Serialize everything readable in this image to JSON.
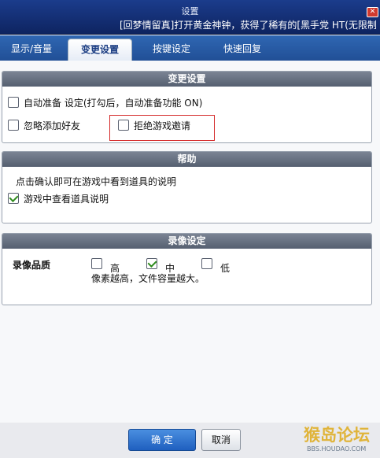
{
  "window": {
    "title": "设置",
    "marquee": "[回梦情留真]打开黄金神钟，获得了稀有的[黑手党 HT(无限制"
  },
  "tabs": [
    {
      "label": "显示/音量"
    },
    {
      "label": "变更设置",
      "active": true
    },
    {
      "label": "按键设定"
    },
    {
      "label": "快速回复"
    }
  ],
  "change_settings": {
    "header": "变更设置",
    "auto_ready": {
      "label": "自动准备 设定(打勾后，自动准备功能 ON)",
      "checked": false
    },
    "ignore_friend": {
      "label": "忽略添加好友",
      "checked": false
    },
    "reject_invite": {
      "label": "拒绝游戏邀请",
      "checked": false
    }
  },
  "help": {
    "header": "帮助",
    "description": "点击确认即可在游戏中看到道具的说明",
    "show_item_desc": {
      "label": "游戏中查看道具说明",
      "checked": true
    }
  },
  "recording": {
    "header": "录像设定",
    "quality_label": "录像品质",
    "options": [
      {
        "label": "高",
        "checked": false
      },
      {
        "label": "中",
        "checked": true
      },
      {
        "label": "低",
        "checked": false
      }
    ],
    "note": "像素越高，文件容量越大。"
  },
  "buttons": {
    "ok": "确 定",
    "cancel": "取消"
  },
  "watermark": {
    "text": "猴岛论坛",
    "sub": "BBS.HOUDAO.COM"
  },
  "colors": {
    "accent": "#214f96",
    "highlight_border": "#d42a2a",
    "check": "#2f8c1e"
  }
}
